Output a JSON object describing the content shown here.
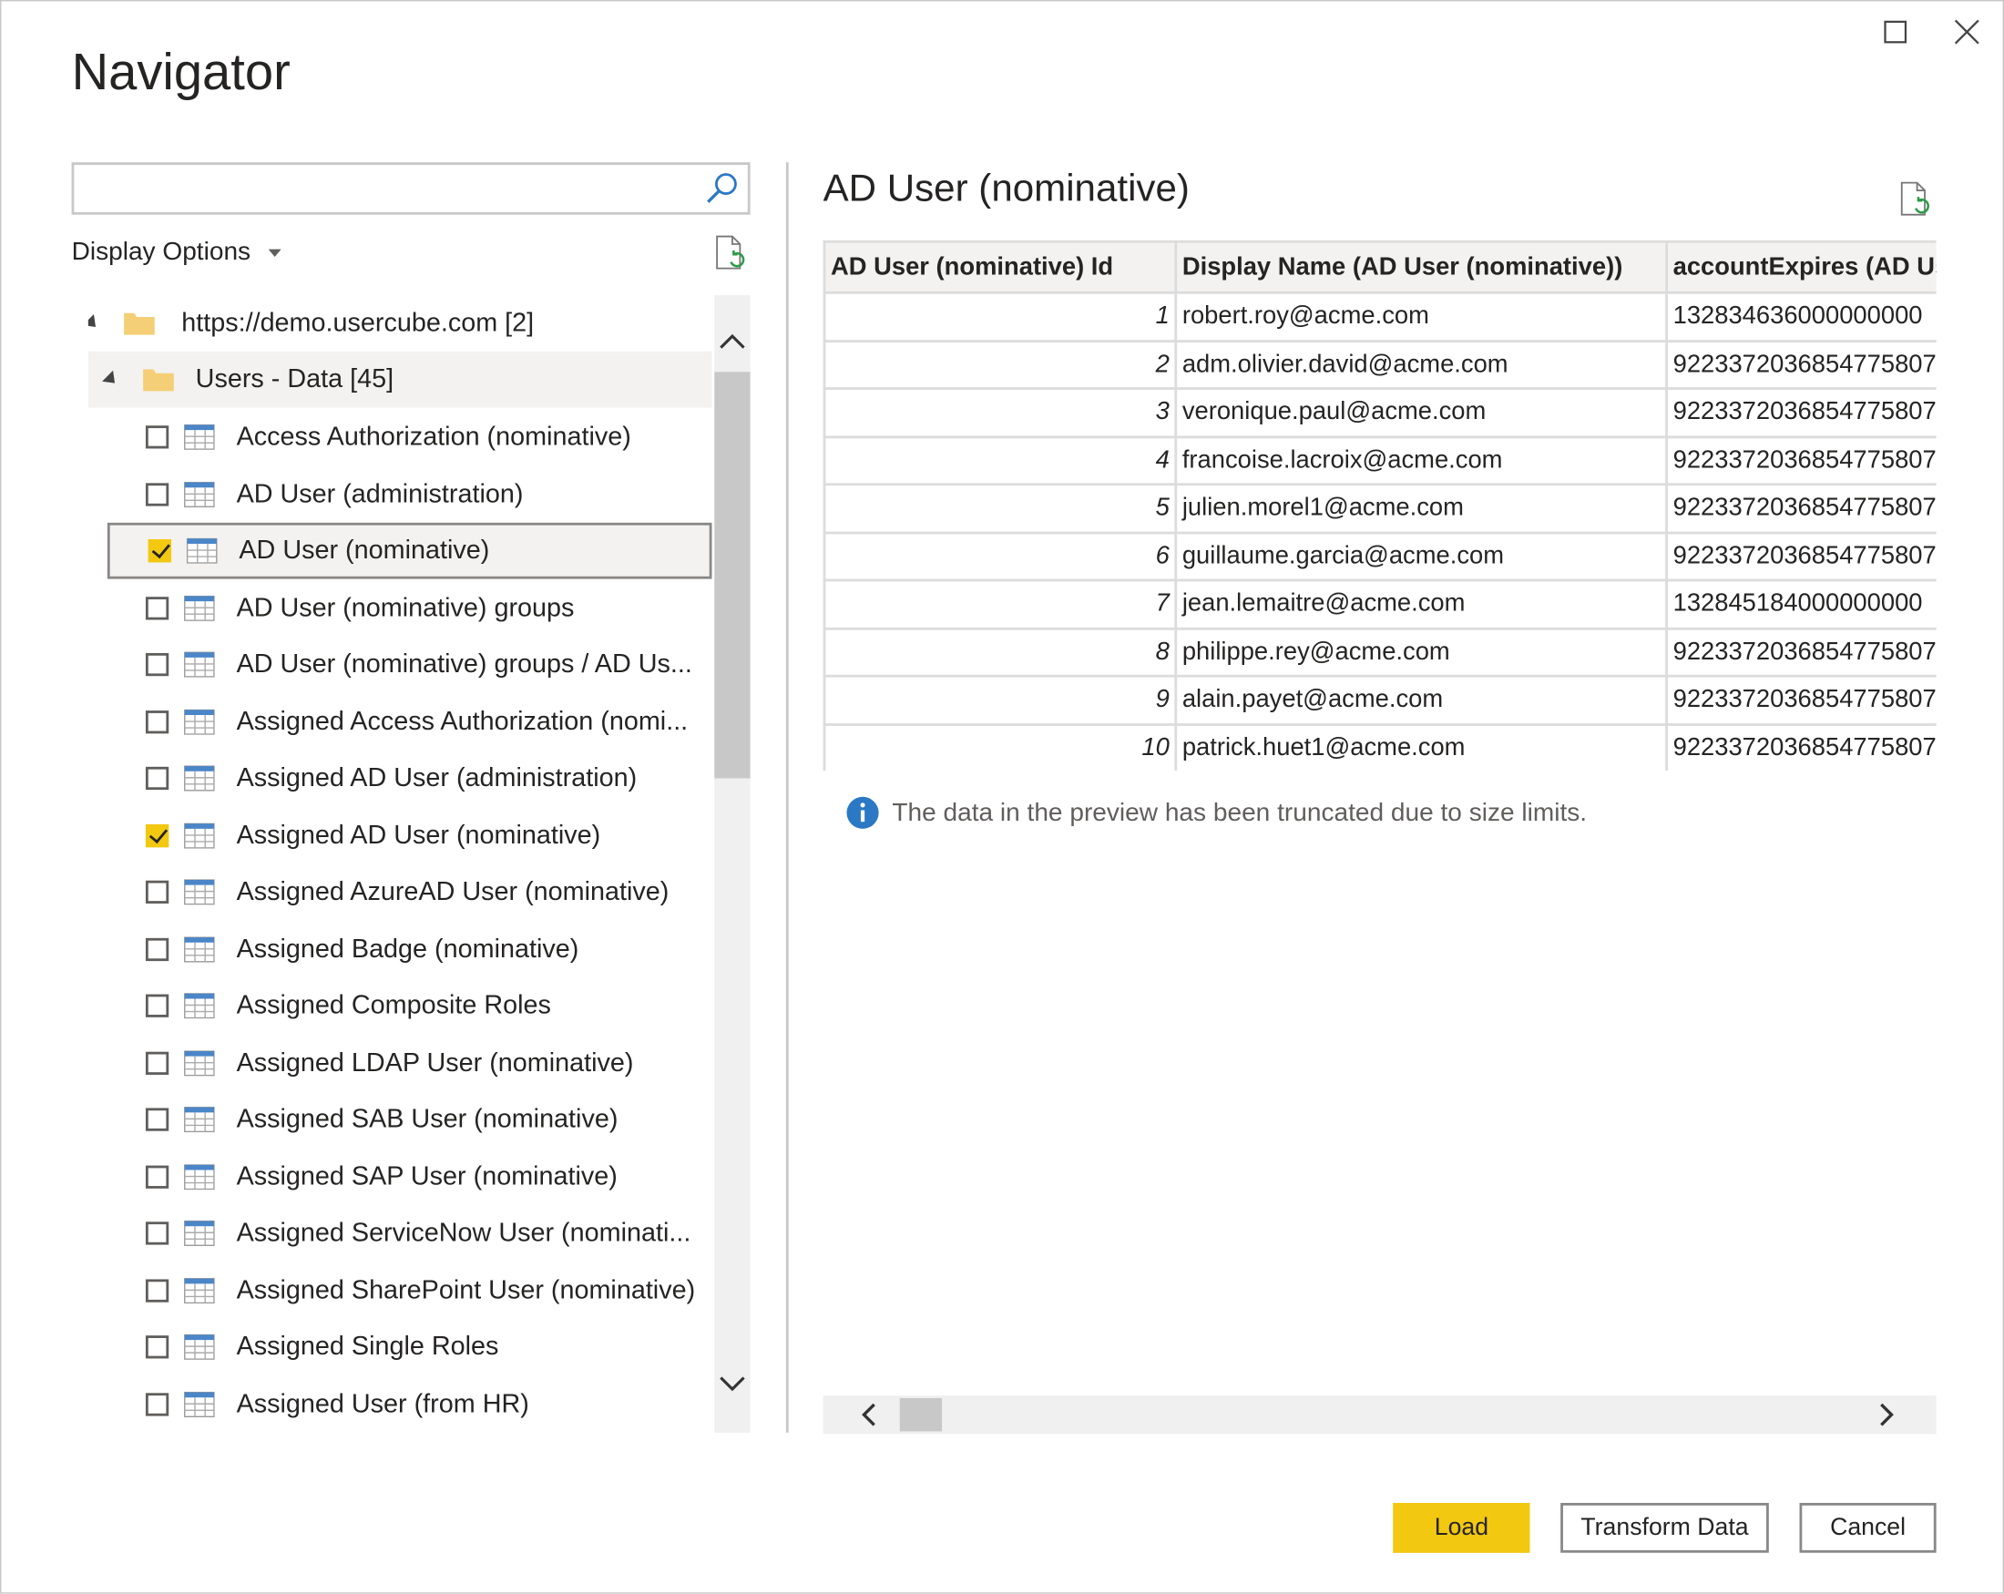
{
  "window": {
    "title": "Navigator",
    "maximize_icon": "maximize-icon",
    "close_icon": "close-icon"
  },
  "search": {
    "value": "",
    "placeholder": ""
  },
  "display_options": "Display Options",
  "tree": {
    "root": {
      "label": "https://demo.usercube.com [2]"
    },
    "folder": {
      "label": "Users - Data [45]"
    },
    "items": [
      {
        "label": "Access Authorization (nominative)",
        "checked": false
      },
      {
        "label": "AD User (administration)",
        "checked": false
      },
      {
        "label": "AD User (nominative)",
        "checked": true,
        "selected": true
      },
      {
        "label": "AD User (nominative) groups",
        "checked": false
      },
      {
        "label": "AD User (nominative) groups / AD Us...",
        "checked": false
      },
      {
        "label": "Assigned Access Authorization (nomi...",
        "checked": false
      },
      {
        "label": "Assigned AD User (administration)",
        "checked": false
      },
      {
        "label": "Assigned AD User (nominative)",
        "checked": true
      },
      {
        "label": "Assigned AzureAD User (nominative)",
        "checked": false
      },
      {
        "label": "Assigned Badge (nominative)",
        "checked": false
      },
      {
        "label": "Assigned Composite Roles",
        "checked": false
      },
      {
        "label": "Assigned LDAP User (nominative)",
        "checked": false
      },
      {
        "label": "Assigned SAB User (nominative)",
        "checked": false
      },
      {
        "label": "Assigned SAP User (nominative)",
        "checked": false
      },
      {
        "label": "Assigned ServiceNow User (nominati...",
        "checked": false
      },
      {
        "label": "Assigned SharePoint User (nominative)",
        "checked": false
      },
      {
        "label": "Assigned Single Roles",
        "checked": false
      },
      {
        "label": "Assigned User (from HR)",
        "checked": false
      }
    ]
  },
  "preview": {
    "title": "AD User (nominative)",
    "columns": [
      "AD User (nominative) Id",
      "Display Name (AD User (nominative))",
      "accountExpires (AD Use"
    ],
    "rows": [
      [
        "1",
        "robert.roy@acme.com",
        "132834636000000000"
      ],
      [
        "2",
        "adm.olivier.david@acme.com",
        "9223372036854775807"
      ],
      [
        "3",
        "veronique.paul@acme.com",
        "9223372036854775807"
      ],
      [
        "4",
        "francoise.lacroix@acme.com",
        "9223372036854775807"
      ],
      [
        "5",
        "julien.morel1@acme.com",
        "9223372036854775807"
      ],
      [
        "6",
        "guillaume.garcia@acme.com",
        "9223372036854775807"
      ],
      [
        "7",
        "jean.lemaitre@acme.com",
        "132845184000000000"
      ],
      [
        "8",
        "philippe.rey@acme.com",
        "9223372036854775807"
      ],
      [
        "9",
        "alain.payet@acme.com",
        "9223372036854775807"
      ],
      [
        "10",
        "patrick.huet1@acme.com",
        "9223372036854775807"
      ]
    ],
    "info": "The data in the preview has been truncated due to size limits."
  },
  "buttons": {
    "load": "Load",
    "transform": "Transform Data",
    "cancel": "Cancel"
  },
  "colors": {
    "accent": "#f2c811",
    "info": "#2b78c5"
  }
}
